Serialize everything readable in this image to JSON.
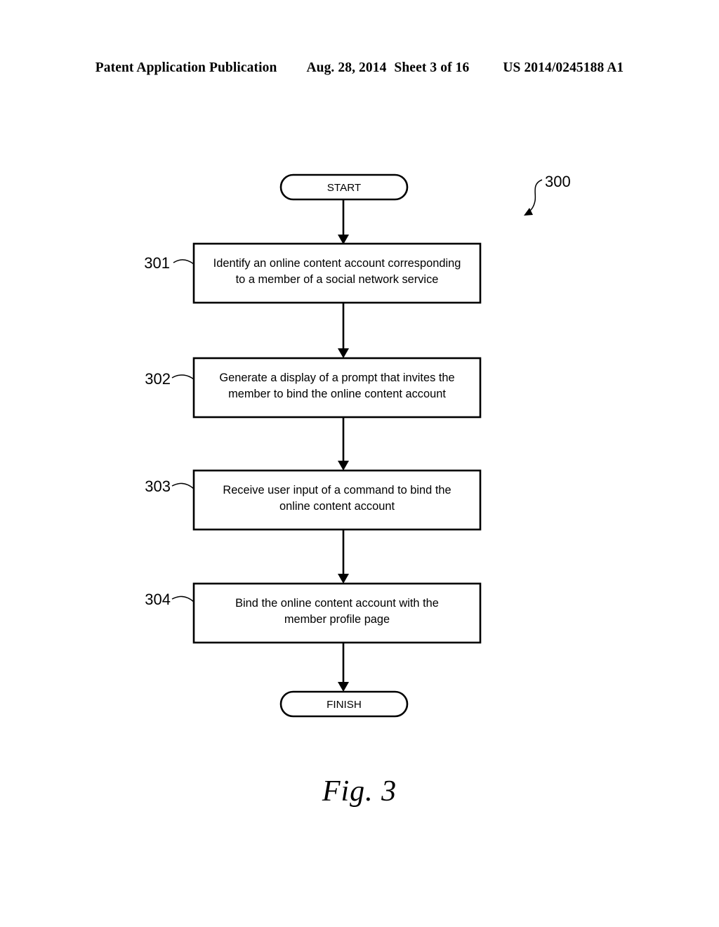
{
  "header": {
    "publication": "Patent Application Publication",
    "date": "Aug. 28, 2014",
    "sheet": "Sheet 3 of 16",
    "patent_number": "US 2014/0245188 A1"
  },
  "figure": {
    "caption": "Fig. 3",
    "diagram_reference": "300",
    "start_label": "START",
    "finish_label": "FINISH",
    "steps": [
      {
        "ref": "301",
        "line1": "Identify an online content account corresponding",
        "line2": "to a member of a social network service"
      },
      {
        "ref": "302",
        "line1": "Generate a display of a prompt that invites the",
        "line2": "member to bind the online content account"
      },
      {
        "ref": "303",
        "line1": "Receive user input of a command to bind the",
        "line2": "online content account"
      },
      {
        "ref": "304",
        "line1": "Bind the online content account with the",
        "line2": "member profile page"
      }
    ]
  }
}
